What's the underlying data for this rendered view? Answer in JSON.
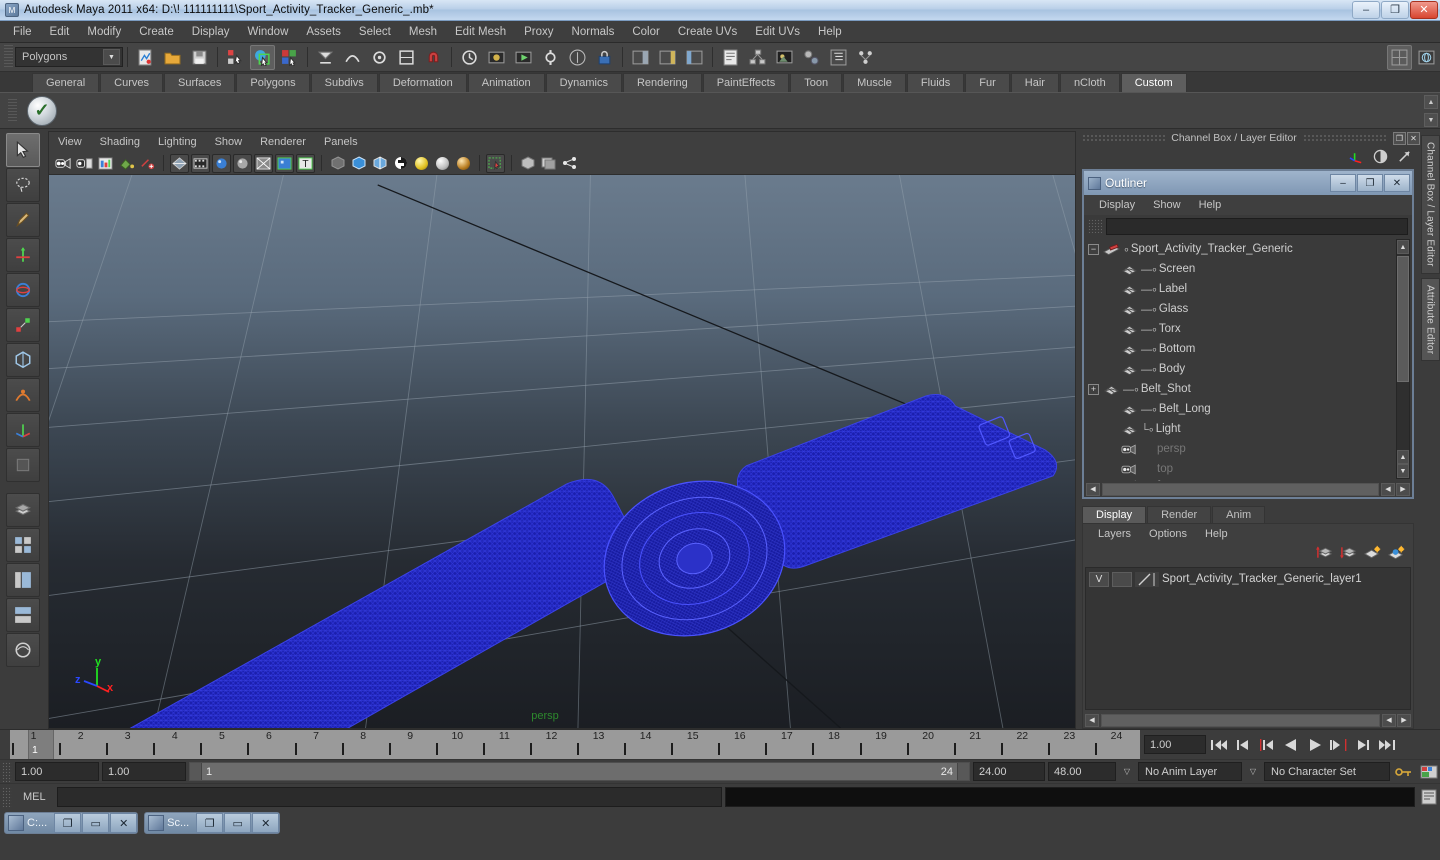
{
  "window": {
    "title": "Autodesk Maya 2011 x64: D:\\! 111111111\\Sport_Activity_Tracker_Generic_.mb*",
    "app_icon": "maya-icon",
    "minimize": "–",
    "maximize": "❐",
    "close": "✕"
  },
  "menubar": {
    "items": [
      {
        "label": "File"
      },
      {
        "label": "Edit"
      },
      {
        "label": "Modify"
      },
      {
        "label": "Create"
      },
      {
        "label": "Display"
      },
      {
        "label": "Window"
      },
      {
        "label": "Assets"
      },
      {
        "label": "Select"
      },
      {
        "label": "Mesh"
      },
      {
        "label": "Edit Mesh"
      },
      {
        "label": "Proxy"
      },
      {
        "label": "Normals"
      },
      {
        "label": "Color"
      },
      {
        "label": "Create UVs"
      },
      {
        "label": "Edit UVs"
      },
      {
        "label": "Help"
      }
    ]
  },
  "statusline": {
    "menuset": "Polygons",
    "menuset_arrow": "▼"
  },
  "shelf": {
    "tabs": [
      {
        "label": "General"
      },
      {
        "label": "Curves"
      },
      {
        "label": "Surfaces"
      },
      {
        "label": "Polygons"
      },
      {
        "label": "Subdivs"
      },
      {
        "label": "Deformation"
      },
      {
        "label": "Animation"
      },
      {
        "label": "Dynamics"
      },
      {
        "label": "Rendering"
      },
      {
        "label": "PaintEffects"
      },
      {
        "label": "Toon"
      },
      {
        "label": "Muscle"
      },
      {
        "label": "Fluids"
      },
      {
        "label": "Fur"
      },
      {
        "label": "Hair"
      },
      {
        "label": "nCloth"
      },
      {
        "label": "Custom"
      }
    ],
    "active_tab": "Custom",
    "item_glyph": "✓",
    "scroll_up": "▲",
    "scroll_down": "▼"
  },
  "viewport": {
    "menu": [
      {
        "label": "View"
      },
      {
        "label": "Shading"
      },
      {
        "label": "Lighting"
      },
      {
        "label": "Show"
      },
      {
        "label": "Renderer"
      },
      {
        "label": "Panels"
      }
    ],
    "camera_label": "persp",
    "axis": {
      "x": "x",
      "y": "y",
      "z": "z",
      "x_color": "#ff2020",
      "y_color": "#21e021",
      "z_color": "#2a48ff"
    },
    "model_color": "#1c20b4",
    "background_top": "#6a7b8d",
    "background_bottom": "#1b1e23"
  },
  "channelbox_dock": {
    "title": "Channel Box / Layer Editor",
    "restore": "❐",
    "close": "✕",
    "icons": [
      "axis-marker-icon",
      "half-circle-icon",
      "arrow-diagonal-icon"
    ]
  },
  "outliner": {
    "title": "Outliner",
    "title_icon": "maya-window-icon",
    "minimize": "–",
    "maximize": "❐",
    "close": "✕",
    "menu": [
      {
        "label": "Display"
      },
      {
        "label": "Show"
      },
      {
        "label": "Help"
      }
    ],
    "search_value": "",
    "search_placeholder": "",
    "nodes": [
      {
        "label": "Sport_Activity_Tracker_Generic",
        "expander": "−",
        "icon": "transform-icon",
        "indent": 0,
        "dim": false
      },
      {
        "label": "Screen",
        "expander": "",
        "icon": "mesh-icon",
        "indent": 1,
        "dim": false
      },
      {
        "label": "Label",
        "expander": "",
        "icon": "mesh-icon",
        "indent": 1,
        "dim": false
      },
      {
        "label": "Glass",
        "expander": "",
        "icon": "mesh-icon",
        "indent": 1,
        "dim": false
      },
      {
        "label": "Torx",
        "expander": "",
        "icon": "mesh-icon",
        "indent": 1,
        "dim": false
      },
      {
        "label": "Bottom",
        "expander": "",
        "icon": "mesh-icon",
        "indent": 1,
        "dim": false
      },
      {
        "label": "Body",
        "expander": "",
        "icon": "mesh-icon",
        "indent": 1,
        "dim": false
      },
      {
        "label": "Belt_Shot",
        "expander": "+",
        "icon": "mesh-icon",
        "indent": 1,
        "dim": false
      },
      {
        "label": "Belt_Long",
        "expander": "",
        "icon": "mesh-icon",
        "indent": 1,
        "dim": false
      },
      {
        "label": "Light",
        "expander": "",
        "icon": "mesh-icon",
        "indent": 1,
        "dim": false
      },
      {
        "label": "persp",
        "expander": "",
        "icon": "camera-icon",
        "indent": 1,
        "dim": true
      },
      {
        "label": "top",
        "expander": "",
        "icon": "camera-icon",
        "indent": 1,
        "dim": true
      },
      {
        "label": "front",
        "expander": "",
        "icon": "camera-icon",
        "indent": 1,
        "dim": true
      }
    ],
    "scroll_up": "▲",
    "scroll_down": "▼",
    "scroll_left": "◀",
    "scroll_right": "▶"
  },
  "layer_editor": {
    "tabs": [
      {
        "label": "Display"
      },
      {
        "label": "Render"
      },
      {
        "label": "Anim"
      }
    ],
    "active_tab": "Display",
    "menu": [
      {
        "label": "Layers"
      },
      {
        "label": "Options"
      },
      {
        "label": "Help"
      }
    ],
    "toolbar_icons": [
      "layer-move-up-icon",
      "layer-move-down-icon",
      "new-layer-icon",
      "new-layer-from-selected-icon"
    ],
    "layers": [
      {
        "visibility": "V",
        "state": "",
        "name": "Sport_Activity_Tracker_Generic_layer1"
      }
    ],
    "scroll_left": "◀",
    "scroll_right": "▶"
  },
  "side_tabs": [
    {
      "label": "Channel Box / Layer Editor",
      "active": false
    },
    {
      "label": "Attribute Editor",
      "active": true
    }
  ],
  "timeline": {
    "frames": [
      1,
      2,
      3,
      4,
      5,
      6,
      7,
      8,
      9,
      10,
      11,
      12,
      13,
      14,
      15,
      16,
      17,
      18,
      19,
      20,
      21,
      22,
      23,
      24
    ],
    "current_frame": "1",
    "current_frame_field": "1.00",
    "playback_buttons": [
      {
        "name": "go-to-start-button",
        "glyph": "|◀◀"
      },
      {
        "name": "step-back-keyframe-button",
        "glyph": "|◀"
      },
      {
        "name": "step-back-frame-button",
        "glyph": "|◀"
      },
      {
        "name": "play-backwards-button",
        "glyph": "◀"
      },
      {
        "name": "play-forwards-button",
        "glyph": "▶"
      },
      {
        "name": "step-forward-frame-button",
        "glyph": "▶|"
      },
      {
        "name": "step-forward-keyframe-button",
        "glyph": "▶|"
      },
      {
        "name": "go-to-end-button",
        "glyph": "▶▶|"
      }
    ]
  },
  "rangebar": {
    "anim_start": "1.00",
    "range_start": "1.00",
    "slider_start": "1",
    "slider_end": "24",
    "range_end": "24.00",
    "anim_end": "48.00",
    "anim_layer": "No Anim Layer",
    "character_set": "No Character Set",
    "dropdown_arrow": "▽"
  },
  "command_line": {
    "label": "MEL",
    "input_value": "",
    "output_value": ""
  },
  "mdi_taskbar": {
    "windows": [
      {
        "label": "C:...",
        "restore": "❐",
        "maximize": "▭",
        "close": "✕"
      },
      {
        "label": "Sc...",
        "restore": "❐",
        "maximize": "▭",
        "close": "✕"
      }
    ]
  }
}
